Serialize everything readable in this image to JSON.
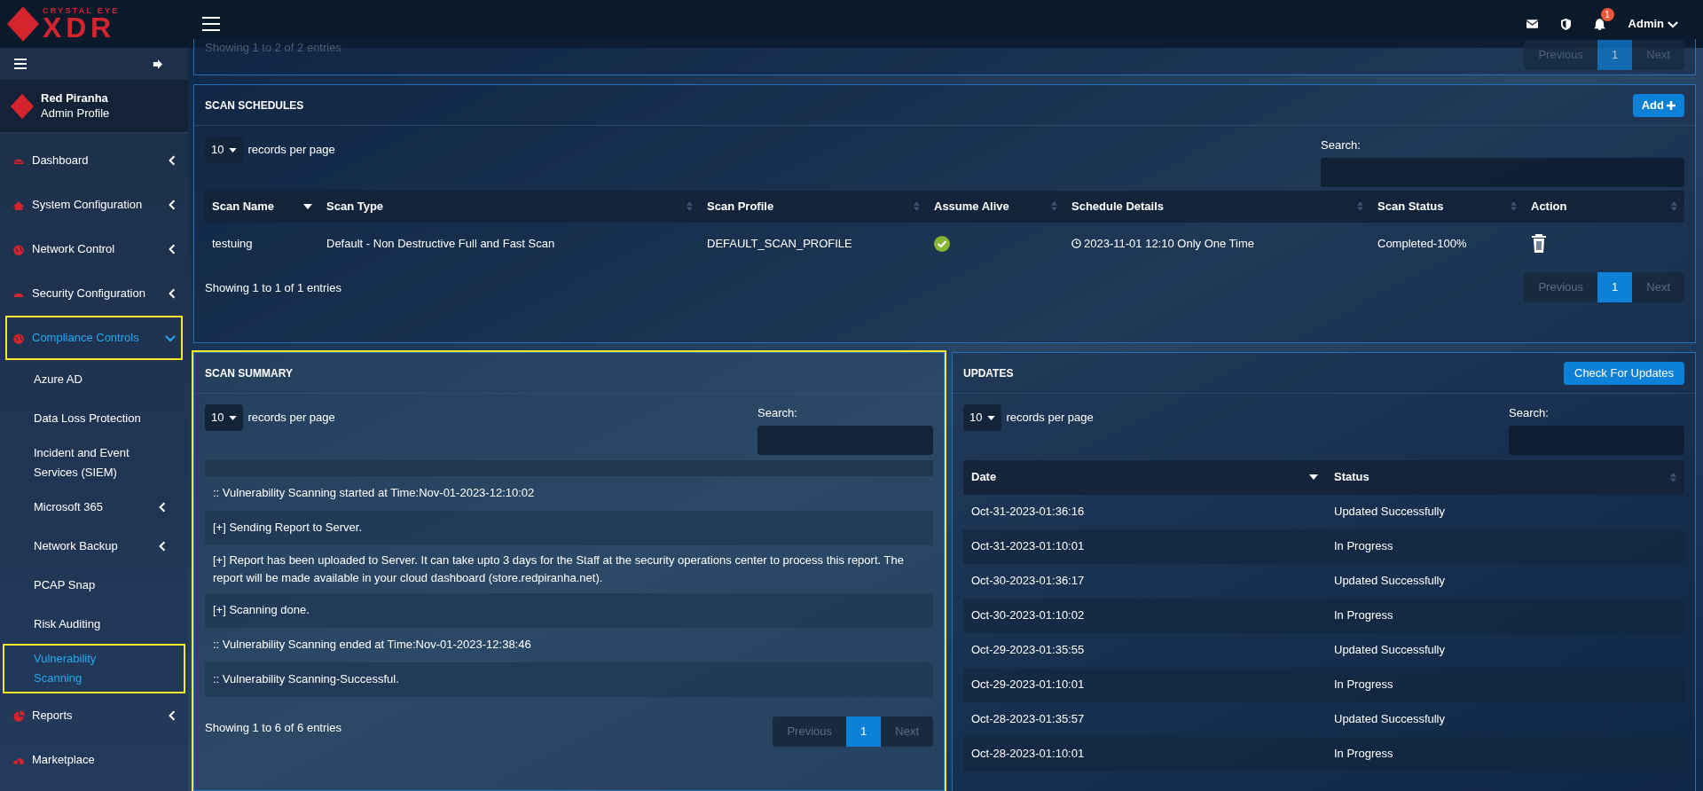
{
  "logo": {
    "tagline": "CRYSTAL EYE",
    "name": "XDR"
  },
  "header": {
    "notification_count": "1",
    "user": "Admin"
  },
  "sidebar": {
    "profile": {
      "name": "Red Piranha",
      "role": "Admin Profile"
    },
    "items": [
      {
        "label": "Dashboard",
        "has_submenu": true,
        "expanded": false,
        "selected": false,
        "highlighted": false
      },
      {
        "label": "System Configuration",
        "has_submenu": true,
        "expanded": false,
        "selected": false,
        "highlighted": false
      },
      {
        "label": "Network Control",
        "has_submenu": true,
        "expanded": false,
        "selected": false,
        "highlighted": false
      },
      {
        "label": "Security Configuration",
        "has_submenu": true,
        "expanded": false,
        "selected": false,
        "highlighted": false
      },
      {
        "label": "Compliance Controls",
        "has_submenu": true,
        "expanded": true,
        "selected": true,
        "highlighted": true,
        "children": [
          {
            "label": "Azure AD",
            "has_submenu": false,
            "selected": false,
            "highlighted": false
          },
          {
            "label": "Data Loss Protection",
            "has_submenu": false,
            "selected": false,
            "highlighted": false
          },
          {
            "label": "Incident and Event Services (SIEM)",
            "has_submenu": false,
            "selected": false,
            "highlighted": false
          },
          {
            "label": "Microsoft 365",
            "has_submenu": true,
            "selected": false,
            "highlighted": false
          },
          {
            "label": "Network Backup",
            "has_submenu": true,
            "selected": false,
            "highlighted": false
          },
          {
            "label": "PCAP Snap",
            "has_submenu": false,
            "selected": false,
            "highlighted": false
          },
          {
            "label": "Risk Auditing",
            "has_submenu": false,
            "selected": false,
            "highlighted": false
          },
          {
            "label": "Vulnerability Scanning",
            "has_submenu": false,
            "selected": true,
            "highlighted": true
          }
        ]
      },
      {
        "label": "Reports",
        "has_submenu": true,
        "expanded": false,
        "selected": false,
        "highlighted": false
      },
      {
        "label": "Marketplace",
        "has_submenu": false,
        "selected": false,
        "highlighted": false
      }
    ]
  },
  "top_panel": {
    "info": "Showing 1 to 2 of 2 entries",
    "pagination": [
      {
        "label": "Previous",
        "selected": false,
        "disabled": true
      },
      {
        "label": "1",
        "selected": true,
        "disabled": false
      },
      {
        "label": "Next",
        "selected": false,
        "disabled": true
      }
    ]
  },
  "scan_schedules": {
    "title": "SCAN SCHEDULES",
    "add_button": "Add",
    "length": "10",
    "length_label": "records per page",
    "search_label": "Search:",
    "columns": [
      {
        "label": "Scan Name",
        "sorted": true
      },
      {
        "label": "Scan Type",
        "sorted": false
      },
      {
        "label": "Scan Profile",
        "sorted": false
      },
      {
        "label": "Assume Alive",
        "sorted": false
      },
      {
        "label": "Schedule Details",
        "sorted": false
      },
      {
        "label": "Scan Status",
        "sorted": false
      },
      {
        "label": "Action",
        "sorted": false
      }
    ],
    "rows": [
      {
        "name": "testuing",
        "type": "Default - Non Destructive Full and Fast Scan",
        "profile": "DEFAULT_SCAN_PROFILE",
        "assume_alive": true,
        "schedule": "2023-11-01 12:10 Only One Time",
        "status": "Completed-100%"
      }
    ],
    "info": "Showing 1 to 1 of 1 entries",
    "pagination": [
      {
        "label": "Previous",
        "selected": false,
        "disabled": true
      },
      {
        "label": "1",
        "selected": true,
        "disabled": false
      },
      {
        "label": "Next",
        "selected": false,
        "disabled": true
      }
    ]
  },
  "scan_summary": {
    "title": "SCAN SUMMARY",
    "highlighted": true,
    "length": "10",
    "length_label": "records per page",
    "search_label": "Search:",
    "lines": [
      ":: Vulnerability Scanning started at Time:Nov-01-2023-12:10:02",
      "[+] Sending Report to Server.",
      "[+] Report has been uploaded to Server. It can take upto 3 days for the Staff at the security operations center to process this report. The report will be made available in your cloud dashboard (store.redpiranha.net).",
      "[+] Scanning done.",
      ":: Vulnerability Scanning ended at Time:Nov-01-2023-12:38:46",
      ":: Vulnerability Scanning-Successful."
    ],
    "info": "Showing 1 to 6 of 6 entries",
    "pagination": [
      {
        "label": "Previous",
        "selected": false,
        "disabled": true
      },
      {
        "label": "1",
        "selected": true,
        "disabled": false
      },
      {
        "label": "Next",
        "selected": false,
        "disabled": true
      }
    ]
  },
  "updates": {
    "title": "UPDATES",
    "button": "Check For Updates",
    "length": "10",
    "length_label": "records per page",
    "search_label": "Search:",
    "columns": [
      {
        "label": "Date",
        "sorted": true
      },
      {
        "label": "Status",
        "sorted": false
      }
    ],
    "rows": [
      {
        "date": "Oct-31-2023-01:36:16",
        "status": "Updated Successfully"
      },
      {
        "date": "Oct-31-2023-01:10:01",
        "status": "In Progress"
      },
      {
        "date": "Oct-30-2023-01:36:17",
        "status": "Updated Successfully"
      },
      {
        "date": "Oct-30-2023-01:10:02",
        "status": "In Progress"
      },
      {
        "date": "Oct-29-2023-01:35:55",
        "status": "Updated Successfully"
      },
      {
        "date": "Oct-29-2023-01:10:01",
        "status": "In Progress"
      },
      {
        "date": "Oct-28-2023-01:35:57",
        "status": "Updated Successfully"
      },
      {
        "date": "Oct-28-2023-01:10:01",
        "status": "In Progress"
      }
    ]
  }
}
